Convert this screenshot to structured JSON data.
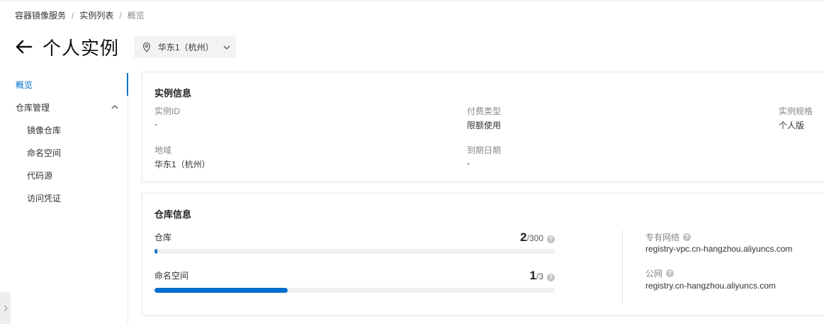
{
  "breadcrumb": [
    {
      "label": "容器镜像服务"
    },
    {
      "label": "实例列表"
    },
    {
      "label": "概览"
    }
  ],
  "header": {
    "title": "个人实例",
    "region": "华东1（杭州）"
  },
  "sidebar": {
    "overview": "概览",
    "repo_mgmt": "仓库管理",
    "items": [
      "镜像仓库",
      "命名空间",
      "代码源",
      "访问凭证"
    ]
  },
  "instance_info": {
    "title": "实例信息",
    "fields": {
      "id_label": "实例ID",
      "id_value": "-",
      "billing_label": "付费类型",
      "billing_value": "限额使用",
      "spec_label": "实例规格",
      "spec_value": "个人版",
      "region_label": "地域",
      "region_value": "华东1（杭州）",
      "expire_label": "到期日期",
      "expire_value": "-"
    }
  },
  "repo_info": {
    "title": "仓库信息",
    "repos": {
      "label": "仓库",
      "used": "2",
      "total": "/300",
      "fraction": 0.0067
    },
    "namespaces": {
      "label": "命名空间",
      "used": "1",
      "total": "/3",
      "fraction": 0.3333
    },
    "vpc_label": "专有网络",
    "vpc_value": "registry-vpc.cn-hangzhou.aliyuncs.com",
    "public_label": "公网",
    "public_value": "registry.cn-hangzhou.aliyuncs.com"
  },
  "colors": {
    "accent": "#0070cc"
  }
}
